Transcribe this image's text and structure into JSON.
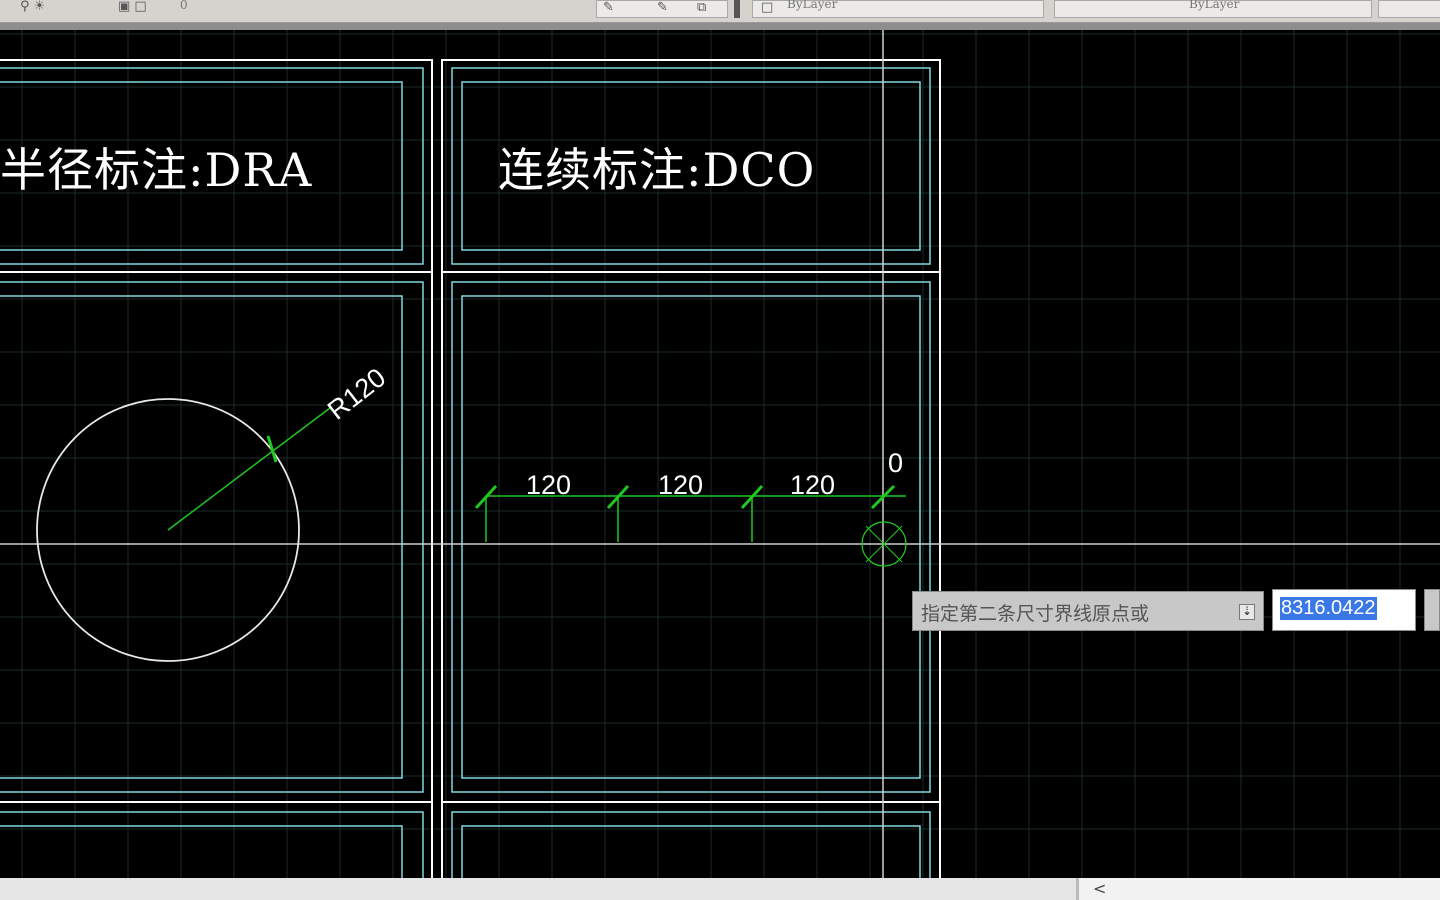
{
  "toolbar": {
    "layer_value": "0",
    "color_value": "ByLayer",
    "linetype_value": "ByLayer"
  },
  "drawing": {
    "panels": [
      {
        "title": "半径标注:DRA"
      },
      {
        "title": "连续标注:DCO"
      }
    ],
    "radius_dimension": {
      "label": "R120",
      "value": 120
    },
    "continuous_dimensions": {
      "labels": [
        "120",
        "120",
        "120",
        "0"
      ]
    }
  },
  "dynamic_input": {
    "prompt": "指定第二条尺寸界线原点或",
    "value": "8316.0422"
  },
  "statusbar": {
    "scroll_left": "<"
  },
  "colors": {
    "background": "#000000",
    "frame_cyan": "#7fd7e0",
    "frame_white": "#ffffff",
    "dimension_green": "#1ec81e",
    "grid": "#1c2a2a",
    "selection_highlight": "#3b78e7"
  }
}
